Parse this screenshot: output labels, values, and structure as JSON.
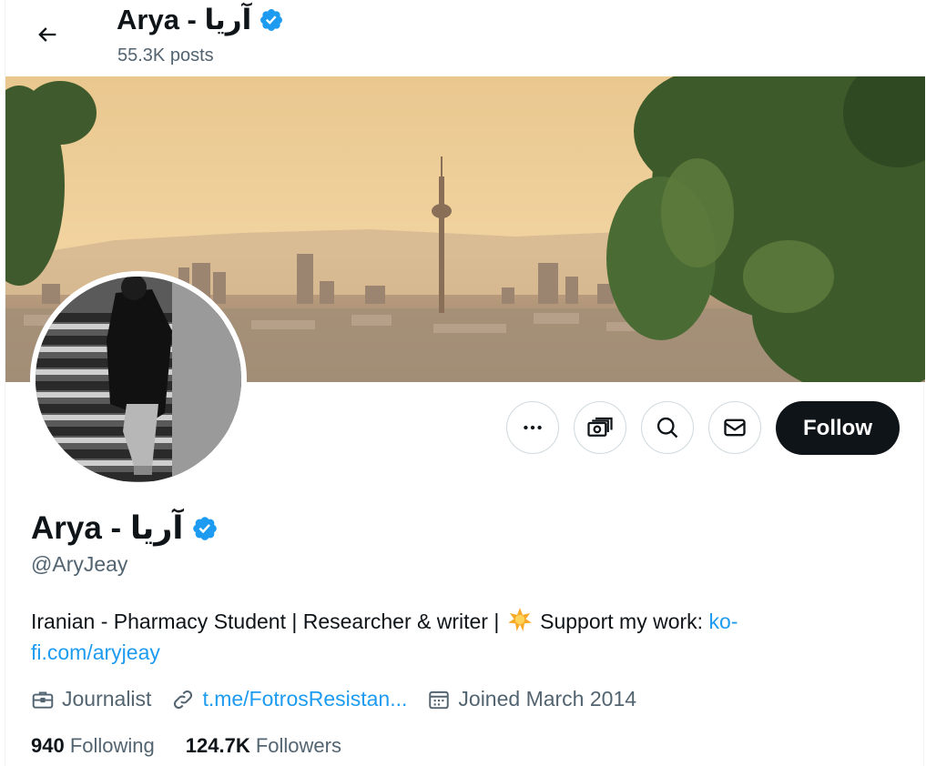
{
  "header": {
    "title": "Arya - آریا",
    "posts": "55.3K posts",
    "back_icon": "arrow-left-icon"
  },
  "profile": {
    "name": "Arya - آریا",
    "handle": "@AryJeay",
    "verified": true,
    "bio_text": "Iranian - Pharmacy Student | Researcher & writer | ",
    "bio_support": " Support my work: ",
    "bio_link": "ko-fi.com/aryjeay",
    "profession": "Journalist",
    "website": "t.me/FotrosResistan...",
    "joined": "Joined March 2014"
  },
  "stats": {
    "following_count": "940",
    "following_label": "Following",
    "followers_count": "124.7K",
    "followers_label": "Followers"
  },
  "actions": {
    "follow_label": "Follow",
    "more_icon": "more-icon",
    "subscribe_icon": "money-icon",
    "search_icon": "search-icon",
    "message_icon": "mail-icon"
  },
  "colors": {
    "accent": "#1d9bf0",
    "text": "#0f1419",
    "muted": "#536471",
    "follow_bg": "#0f1419"
  }
}
